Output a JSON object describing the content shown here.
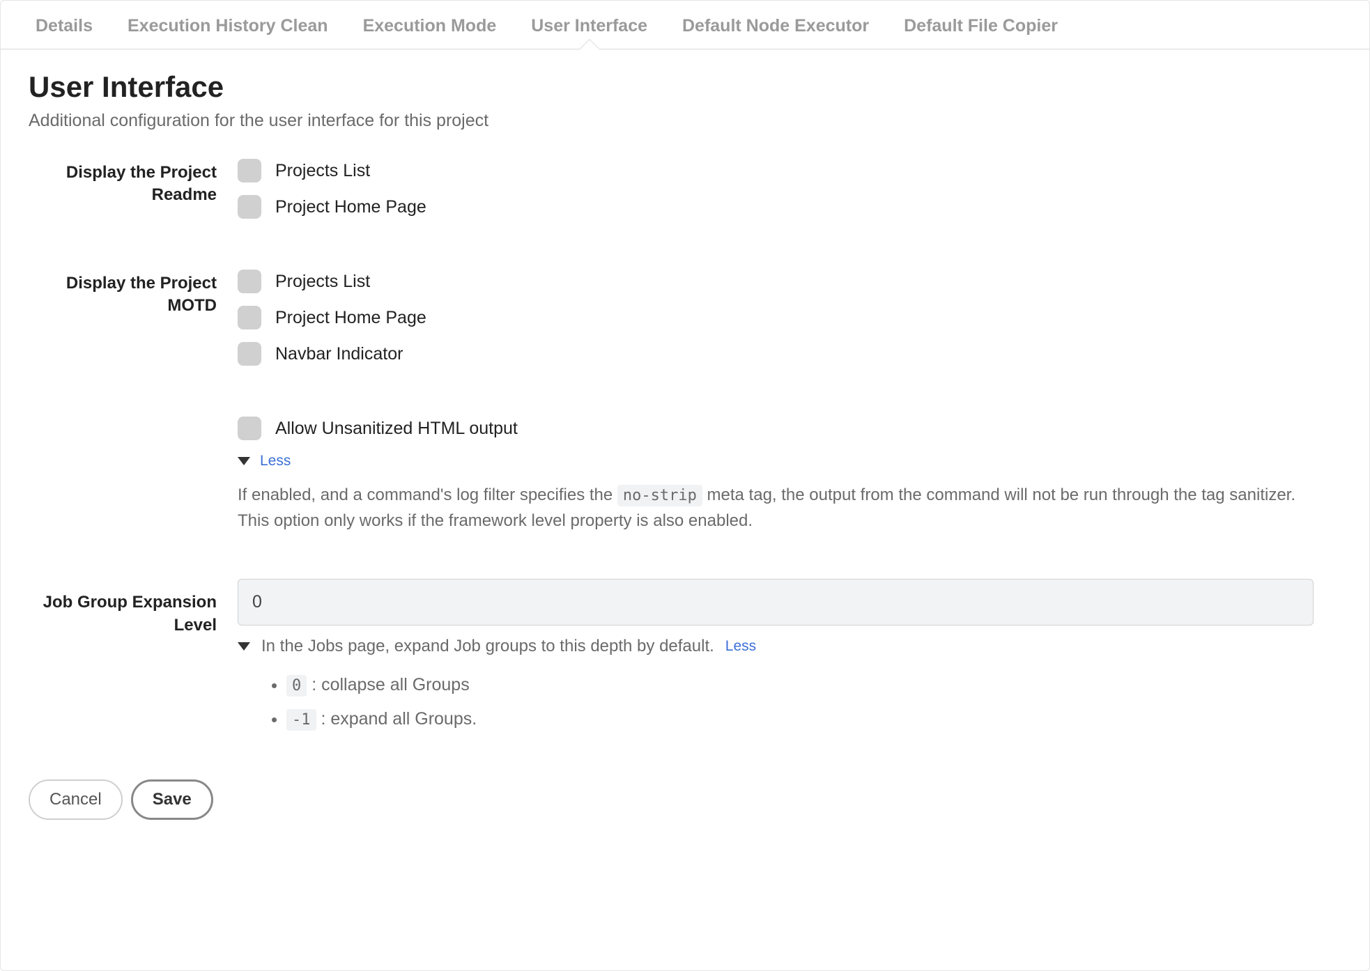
{
  "tabs": [
    {
      "label": "Details"
    },
    {
      "label": "Execution History Clean"
    },
    {
      "label": "Execution Mode"
    },
    {
      "label": "User Interface",
      "active": true
    },
    {
      "label": "Default Node Executor"
    },
    {
      "label": "Default File Copier"
    }
  ],
  "header": {
    "title": "User Interface",
    "subtitle": "Additional configuration for the user interface for this project"
  },
  "readme": {
    "label": "Display the Project Readme",
    "options": [
      {
        "label": "Projects List"
      },
      {
        "label": "Project Home Page"
      }
    ]
  },
  "motd": {
    "label": "Display the Project MOTD",
    "options": [
      {
        "label": "Projects List"
      },
      {
        "label": "Project Home Page"
      },
      {
        "label": "Navbar Indicator"
      }
    ]
  },
  "html_output": {
    "check_label": "Allow Unsanitized HTML output",
    "toggle_label": "Less",
    "help_prefix": "If enabled, and a command's log filter specifies the ",
    "help_code": "no-strip",
    "help_suffix": " meta tag, the output from the command will not be run through the tag sanitizer. This option only works if the framework level property is also enabled."
  },
  "job_group": {
    "label": "Job Group Expansion Level",
    "value": "0",
    "hint_text": "In the Jobs page, expand Job groups to this depth by default.",
    "toggle_label": "Less",
    "items": [
      {
        "code": "0",
        "text": " : collapse all Groups"
      },
      {
        "code": "-1",
        "text": " : expand all Groups."
      }
    ]
  },
  "footer": {
    "cancel": "Cancel",
    "save": "Save"
  }
}
